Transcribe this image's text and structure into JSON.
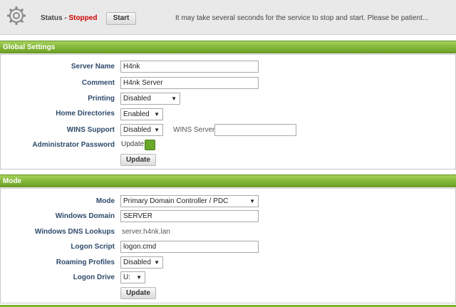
{
  "status_bar": {
    "status_label": "Status",
    "separator": " - ",
    "status_value": "Stopped",
    "start_label": "Start",
    "message": "It may take several seconds for the service to stop and start.  Please be patient...",
    "gear_icon": "gear-icon",
    "status_color": "#cc0000"
  },
  "global": {
    "title": "Global Settings",
    "server_name_label": "Server Name",
    "server_name_value": "H4nk",
    "comment_label": "Comment",
    "comment_value": "H4nk Server",
    "printing_label": "Printing",
    "printing_value": "Disabled",
    "home_dirs_label": "Home Directories",
    "home_dirs_value": "Enabled",
    "wins_support_label": "WINS Support",
    "wins_support_value": "Disabled",
    "wins_server_label": "WINS Server",
    "wins_server_value": "",
    "admin_pw_label": "Administrator Password",
    "admin_pw_link": "Update",
    "update_label": "Update"
  },
  "mode": {
    "title": "Mode",
    "mode_label": "Mode",
    "mode_value": "Primary Domain Controller / PDC",
    "domain_label": "Windows Domain",
    "domain_value": "SERVER",
    "dns_label": "Windows DNS Lookups",
    "dns_value": "server.h4nk.lan",
    "logon_script_label": "Logon Script",
    "logon_script_value": "logon.cmd",
    "roaming_label": "Roaming Profiles",
    "roaming_value": "Disabled",
    "logon_drive_label": "Logon Drive",
    "logon_drive_value": "U:",
    "update_label": "Update"
  },
  "colors": {
    "section_bar": "#7eb233",
    "label_text": "#2e4a6b"
  }
}
